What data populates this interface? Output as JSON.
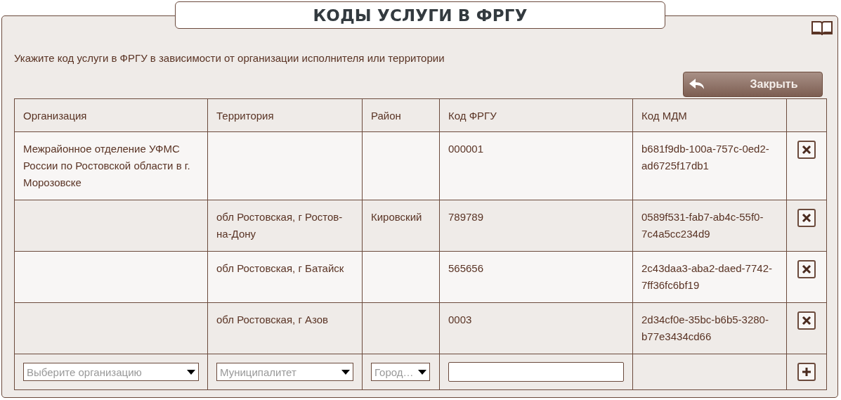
{
  "title": "КОДЫ УСЛУГИ В ФРГУ",
  "instruction": "Укажите код услуги в ФРГУ в зависимости от организации исполнителя или территории",
  "close_button": "Закрыть",
  "table": {
    "columns": [
      "Организация",
      "Территория",
      "Район",
      "Код ФРГУ",
      "Код МДМ"
    ],
    "rows": [
      {
        "cells": [
          "Межрайонное отделение УФМС России по Ростовской области в г. Морозовске",
          "",
          "",
          "000001",
          "b681f9db-100a-757c-0ed2-ad6725f17db1"
        ]
      },
      {
        "cells": [
          "",
          "обл Ростовская, г Ростов-на-Дону",
          "Кировский",
          "789789",
          "0589f531-fab7-ab4c-55f0-7c4a5cc234d9"
        ]
      },
      {
        "cells": [
          "",
          "обл Ростовская, г Батайск",
          "",
          "565656",
          "2c43daa3-aba2-daed-7742-7ff36fc6bf19"
        ]
      },
      {
        "cells": [
          "",
          "обл Ростовская, г Азов",
          "",
          "0003",
          "2d34cf0e-35bc-b6b5-3280-b77e3434cd66"
        ]
      }
    ],
    "new_row": {
      "organization": {
        "placeholder": "Выберите организацию"
      },
      "territory": {
        "placeholder": "Муниципалитет"
      },
      "district": {
        "placeholder": "Город…"
      }
    }
  }
}
